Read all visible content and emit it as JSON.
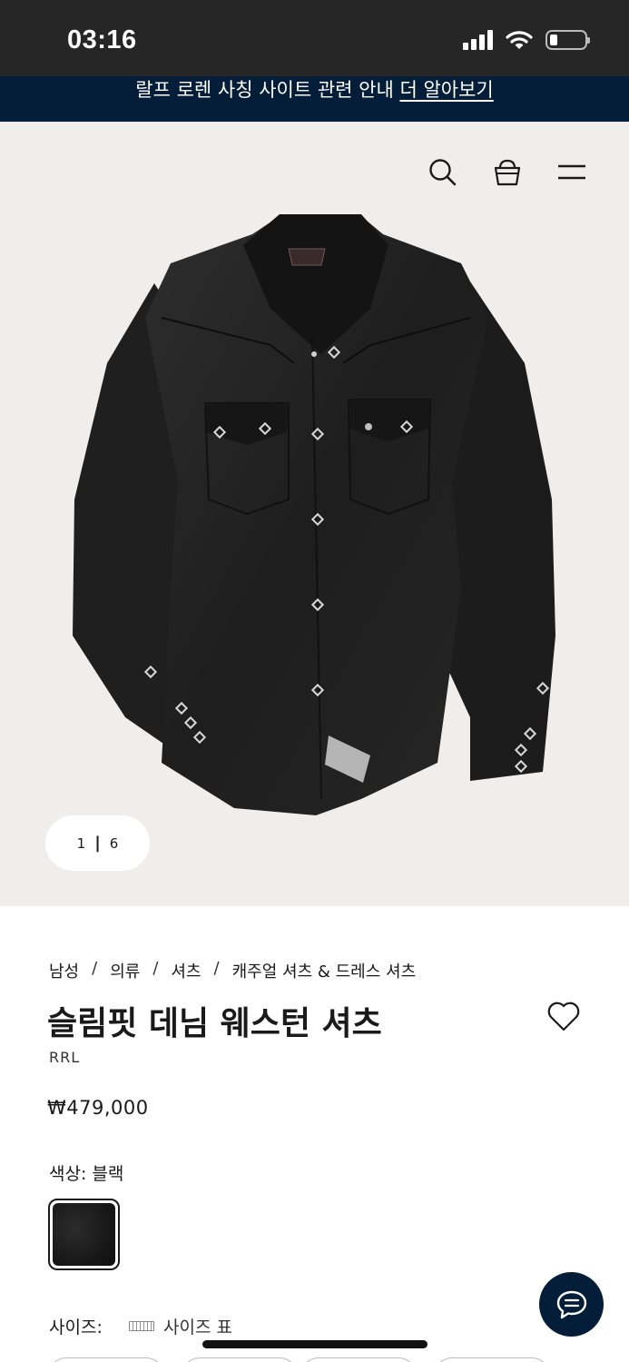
{
  "status_bar": {
    "time": "03:16"
  },
  "promo_banner": {
    "text": "랄프 로렌 사칭 사이트 관련 안내 ",
    "link": "더 알아보기"
  },
  "header": {
    "icons": [
      "search-icon",
      "shopping-bag-icon",
      "menu-icon"
    ]
  },
  "gallery": {
    "current": "1",
    "separator": "|",
    "total": "6"
  },
  "breadcrumb": {
    "items": [
      "남성",
      "의류",
      "셔츠",
      "캐주얼 셔츠 & 드레스 셔츠"
    ],
    "separator": "/"
  },
  "product": {
    "title": "슬림핏 데님 웨스턴 셔츠",
    "brand": "RRL",
    "price": "₩479,000",
    "color_label": "색상: 블랙",
    "size_label": "사이즈:",
    "size_chart": "사이즈 표"
  },
  "colors": {
    "banner_bg": "#041e3a",
    "hero_bg": "#efeeed",
    "status_bg": "#262626"
  }
}
